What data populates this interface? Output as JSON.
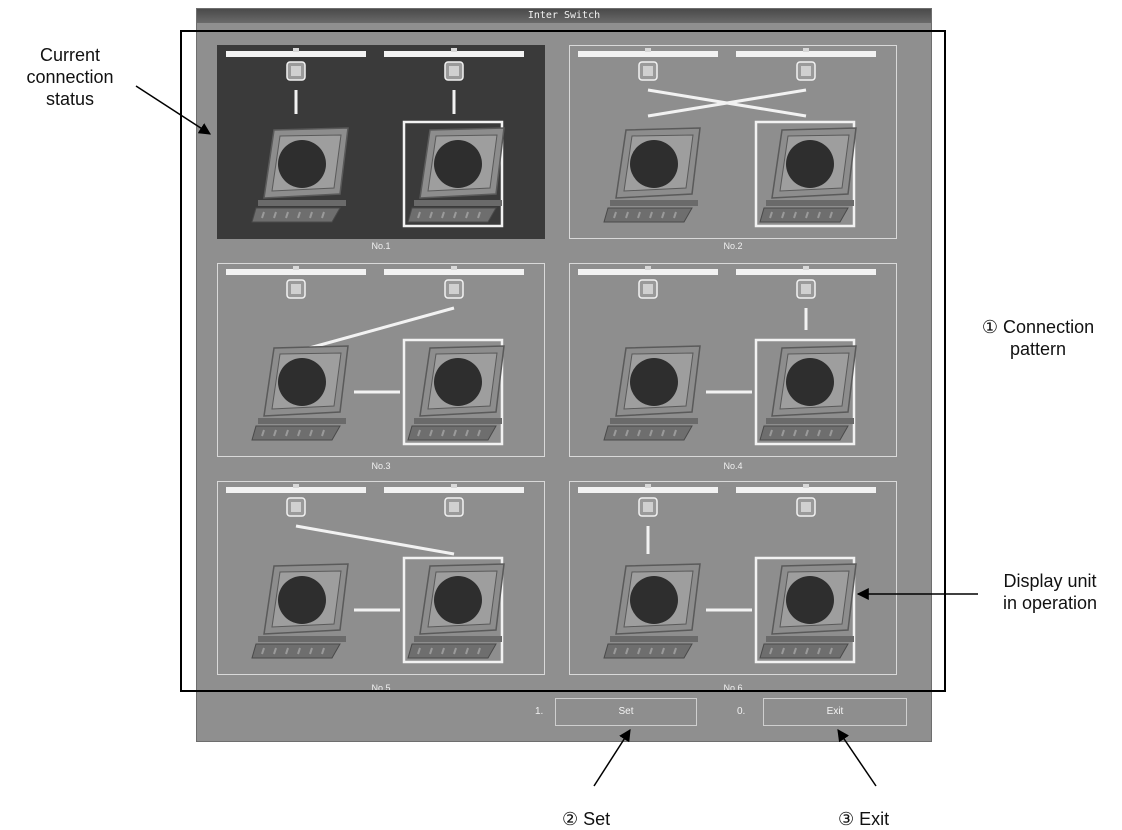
{
  "window": {
    "title": "Inter Switch"
  },
  "patterns": [
    {
      "label": "No.1",
      "current": true
    },
    {
      "label": "No.2",
      "current": false
    },
    {
      "label": "No.3",
      "current": false
    },
    {
      "label": "No.4",
      "current": false
    },
    {
      "label": "No.5",
      "current": false
    },
    {
      "label": "No.6",
      "current": false
    }
  ],
  "buttons": {
    "set_number": "1.",
    "set_label": "Set",
    "exit_number": "0.",
    "exit_label": "Exit"
  },
  "annotations": {
    "current_status": [
      "Current",
      "connection",
      "status"
    ],
    "connection_pattern": [
      "① Connection",
      "pattern"
    ],
    "display_unit": [
      "Display unit",
      "in operation"
    ],
    "set": "② Set",
    "exit": "③ Exit"
  },
  "colors": {
    "window_bg": "#8f8f8f",
    "active_panel_bg": "#3a3a3a",
    "panel_border": "#d9d9d9",
    "annotation_text": "#111111"
  }
}
